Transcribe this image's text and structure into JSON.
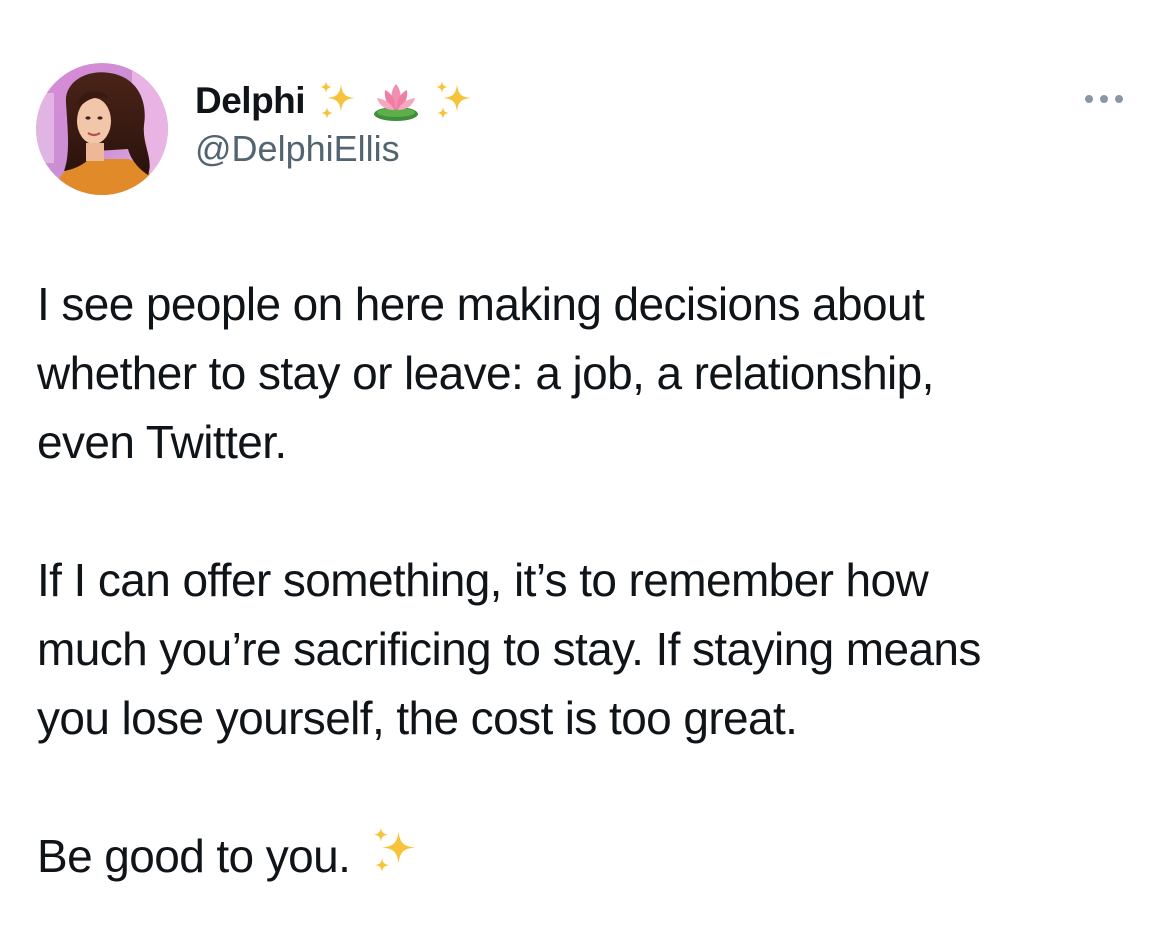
{
  "author": {
    "display_name": "Delphi",
    "name_emojis": [
      "sparkles-icon",
      "lotus-icon",
      "sparkles-icon"
    ],
    "handle": "@DelphiEllis",
    "avatar": "profile-photo"
  },
  "menu": {
    "icon": "more-horizontal-icon"
  },
  "tweet": {
    "paragraphs": [
      {
        "lines": [
          "I see people on here making decisions about",
          "whether to stay or leave: a job, a relationship,",
          "even Twitter."
        ]
      },
      {
        "lines": [
          "If I can offer something, it’s to remember how",
          "much you’re sacrificing to stay. If staying means",
          "you lose yourself, the cost is too great."
        ]
      },
      {
        "lines": [
          "Be good to you."
        ],
        "trailing_emoji": "sparkles-icon"
      }
    ]
  },
  "colors": {
    "text": "#0f1419",
    "secondary_text": "#536471",
    "sparkle_gold": "#f6c33a",
    "lotus_pink": "#f28fb0",
    "lotus_leaf": "#3f8f3a",
    "background": "#ffffff"
  }
}
